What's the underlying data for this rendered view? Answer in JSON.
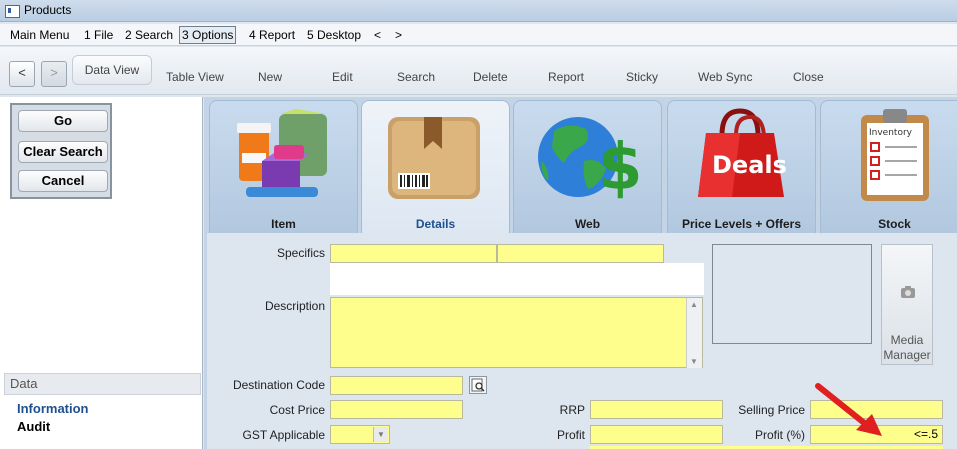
{
  "window": {
    "title": "Products"
  },
  "menu": [
    {
      "label": "Main Menu"
    },
    {
      "label": "1 File"
    },
    {
      "label": "2 Search"
    },
    {
      "label": "3 Options"
    },
    {
      "label": "4 Report"
    },
    {
      "label": "5 Desktop"
    },
    {
      "label": "<"
    },
    {
      "label": ">"
    }
  ],
  "toolbar": {
    "back": "<",
    "forward": ">",
    "data_view": "Data View",
    "table_view": "Table View",
    "new": "New",
    "edit": "Edit",
    "search": "Search",
    "delete": "Delete",
    "report": "Report",
    "sticky": "Sticky",
    "web_sync": "Web Sync",
    "close": "Close"
  },
  "search_panel": {
    "go": "Go",
    "clear_search": "Clear Search",
    "cancel": "Cancel"
  },
  "data_section": {
    "header": "Data",
    "items": [
      "Information",
      "Audit"
    ]
  },
  "tabs": [
    {
      "label": "Item",
      "icon": "bottles-icon"
    },
    {
      "label": "Details",
      "icon": "box-icon"
    },
    {
      "label": "Web",
      "icon": "globe-dollar-icon"
    },
    {
      "label": "Price Levels + Offers",
      "icon": "deals-bag-icon"
    },
    {
      "label": "Stock",
      "icon": "clipboard-icon"
    }
  ],
  "selected_tab": "Details",
  "image_banner": {
    "deals_text": "Deals",
    "inventory_text": "Inventory"
  },
  "form": {
    "specifics_label": "Specifics",
    "description_label": "Description",
    "destination_code_label": "Destination Code",
    "cost_price_label": "Cost Price",
    "rrp_label": "RRP",
    "selling_price_label": "Selling Price",
    "gst_label": "GST Applicable",
    "profit_label": "Profit",
    "profit_pct_label": "Profit (%)",
    "profit_pct_value": "<=.5",
    "scroll_up": "▲",
    "scroll_down": "▼",
    "dropdown_arrow": "▼"
  },
  "media": {
    "label": "Media Manager"
  },
  "colors": {
    "field_yellow": "#fefe8c",
    "arrow_red": "#e02020",
    "selected_tab_text": "#1f4f8f"
  }
}
